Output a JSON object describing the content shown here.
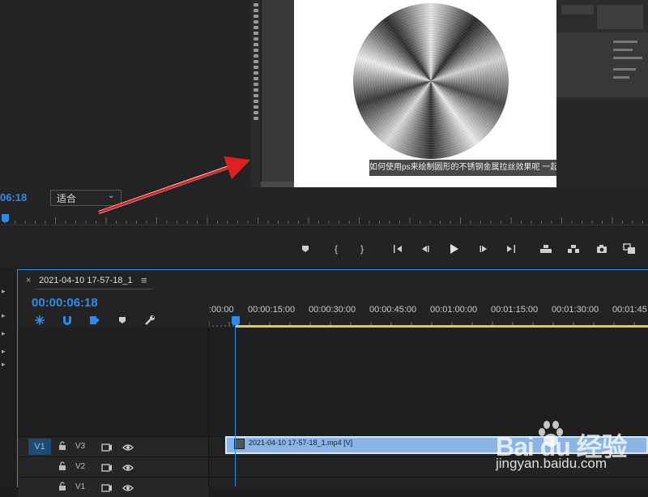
{
  "monitor": {
    "timecode": "06:18",
    "fit_select": "适合",
    "subtitle": "如何使用ps来绘制圆形的不锈钢金属拉丝效果呢 一起来看一下吧"
  },
  "transport": {
    "icons": [
      "marker-icon",
      "mark-in-icon",
      "mark-out-icon",
      "go-to-in-icon",
      "step-back-icon",
      "play-icon",
      "step-forward-icon",
      "go-to-out-icon",
      "lift-icon",
      "extract-icon",
      "export-frame-icon",
      "comparison-view-icon"
    ]
  },
  "timeline": {
    "sequence_name": "2021-04-10 17-57-18_1",
    "close_glyph": "×",
    "menu_glyph": "≡",
    "timecode": "00:00:06:18",
    "ruler_labels": [
      ":00:00",
      "00:00:15:00",
      "00:00:30:00",
      "00:00:45:00",
      "00:01:00:00",
      "00:01:15:00",
      "00:01:30:00",
      "00:01:45"
    ],
    "tracks": [
      {
        "patch": "V1",
        "name": "V3"
      },
      {
        "patch": "",
        "name": "V2"
      },
      {
        "patch": "",
        "name": "V1"
      }
    ],
    "clip_label": "2021-04-10 17-57-18_1.mp4 [V]"
  },
  "watermark": {
    "logo": "Bai du 经验",
    "url": "jingyan.baidu.com"
  },
  "colors": {
    "accent": "#2d8ceb",
    "clip": "#8ab4e4",
    "work_area": "#e6c84a",
    "arrow": "#e02020"
  }
}
